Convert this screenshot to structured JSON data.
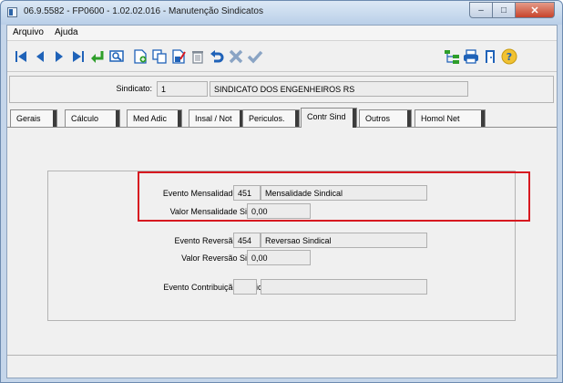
{
  "window": {
    "title": "06.9.5582 - FP0600 - 1.02.02.016 - Manutenção Sindicatos"
  },
  "menu": {
    "items": [
      "Arquivo",
      "Ajuda"
    ]
  },
  "toolbar": {
    "buttons": [
      "first-record",
      "previous-record",
      "next-record",
      "last-record",
      "enter",
      "search",
      "new-document",
      "copy",
      "edit",
      "delete",
      "undo",
      "cancel",
      "confirm",
      "tree",
      "print",
      "exit",
      "help"
    ],
    "colors": {
      "primary": "#1f62b8",
      "green": "#2e9e2a",
      "yellow": "#f1c232"
    }
  },
  "sindicato": {
    "label": "Sindicato:",
    "code": "1",
    "name": "SINDICATO DOS ENGENHEIROS RS"
  },
  "tabs": [
    "Gerais",
    "Cálculo",
    "Med Adic",
    "Insal / Not",
    "Periculos.",
    "Contr Sind",
    "Outros",
    "Homol Net"
  ],
  "active_tab": "Contr Sind",
  "form": {
    "evento_mensalidade": {
      "label": "Evento Mensalidade Sindical:",
      "code": "451",
      "desc": "Mensalidade Sindical"
    },
    "valor_mensalidade": {
      "label": "Valor Mensalidade Sindical:",
      "value": "0,00"
    },
    "evento_reversao": {
      "label": "Evento Reversão Sindical:",
      "code": "454",
      "desc": "Reversao Sindical"
    },
    "valor_reversao": {
      "label": "Valor Reversão Sindical:",
      "value": "0,00"
    },
    "evento_contribuicao": {
      "label": "Evento Contribuição Sindical:",
      "code": "",
      "desc": ""
    }
  },
  "highlight_color": "#d71920"
}
